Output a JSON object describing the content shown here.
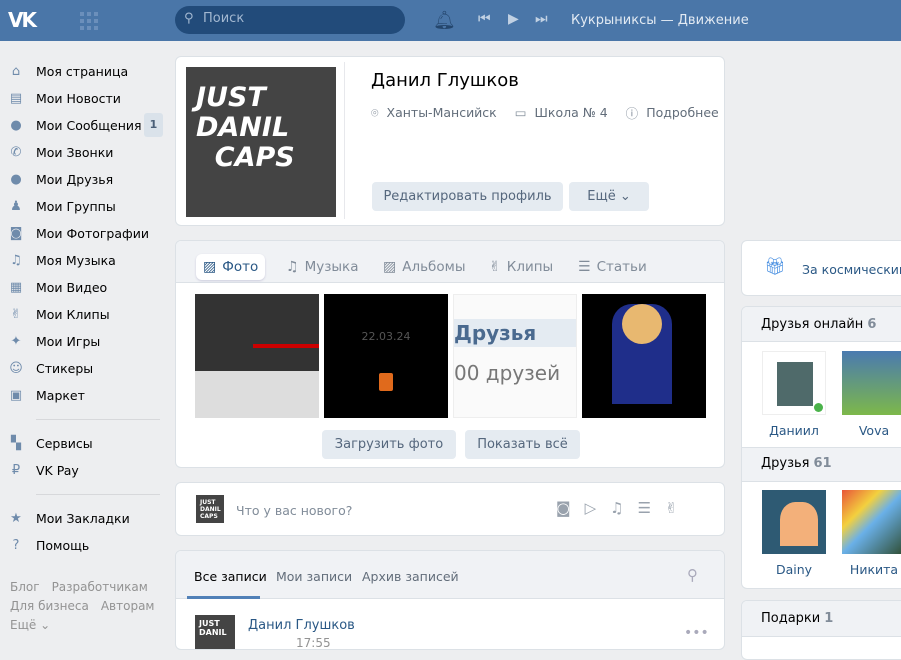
{
  "header": {
    "logo": "VK",
    "search_placeholder": "Поиск",
    "track": "Кукрыниксы — Движение"
  },
  "sidebar": {
    "items": [
      {
        "icon": "home-icon",
        "glyph": "⌂",
        "label": "Моя страница"
      },
      {
        "icon": "news-icon",
        "glyph": "▤",
        "label": "Мои Новости"
      },
      {
        "icon": "messages-icon",
        "glyph": "●",
        "label": "Мои Сообщения",
        "badge": "1"
      },
      {
        "icon": "phone-icon",
        "glyph": "✆",
        "label": "Мои Звонки"
      },
      {
        "icon": "user-icon",
        "glyph": "●",
        "label": "Мои Друзья"
      },
      {
        "icon": "groups-icon",
        "glyph": "♟",
        "label": "Мои Группы"
      },
      {
        "icon": "camera-icon",
        "glyph": "◙",
        "label": "Мои Фотографии"
      },
      {
        "icon": "music-icon",
        "glyph": "♫",
        "label": "Моя Музыка"
      },
      {
        "icon": "video-icon",
        "glyph": "▦",
        "label": "Мои Видео"
      },
      {
        "icon": "clips-icon",
        "glyph": "✌",
        "label": "Мои Клипы"
      },
      {
        "icon": "games-icon",
        "glyph": "✦",
        "label": "Мои Игры"
      },
      {
        "icon": "stickers-icon",
        "glyph": "☺",
        "label": "Стикеры"
      },
      {
        "icon": "market-icon",
        "glyph": "▣",
        "label": "Маркет"
      }
    ],
    "items2": [
      {
        "icon": "services-icon",
        "glyph": "▚",
        "label": "Сервисы"
      },
      {
        "icon": "vkpay-icon",
        "glyph": "₽",
        "label": "VK Pay"
      }
    ],
    "items3": [
      {
        "icon": "star-icon",
        "glyph": "★",
        "label": "Мои Закладки"
      },
      {
        "icon": "help-icon",
        "glyph": "?",
        "label": "Помощь"
      }
    ],
    "footer": {
      "blog": "Блог",
      "dev": "Разработчикам",
      "biz": "Для бизнеса",
      "authors": "Авторам",
      "more": "Ещё ⌄"
    }
  },
  "profile": {
    "avatar_text": "JUST DANIL CAPS",
    "name": "Данил Глушков",
    "city": "Ханты-Мансийск",
    "school": "Школа № 4",
    "more": "Подробнее",
    "edit": "Редактировать профиль",
    "extra": "Ещё ⌄"
  },
  "media": {
    "tabs": [
      "Фото",
      "Музыка",
      "Альбомы",
      "Клипы",
      "Статьи"
    ],
    "photo_date": "22.03.24",
    "photo_friends1": "Друзья",
    "photo_friends2": "00 друзей",
    "upload": "Загрузить фото",
    "show_all": "Показать всё"
  },
  "composer": {
    "placeholder": "Что у вас нового?"
  },
  "wall": {
    "tabs": [
      "Все записи",
      "Мои записи",
      "Архив записей"
    ],
    "post_author": "Данил Глушков",
    "post_time": "17:55"
  },
  "right": {
    "gift_text": "За космическим",
    "online_label": "Друзья онлайн",
    "online_count": "6",
    "online": [
      "Даниил",
      "Vova"
    ],
    "friends_label": "Друзья",
    "friends_count": "61",
    "friends": [
      "Dainy",
      "Никита"
    ],
    "gifts_label": "Подарки",
    "gifts_count": "1"
  }
}
